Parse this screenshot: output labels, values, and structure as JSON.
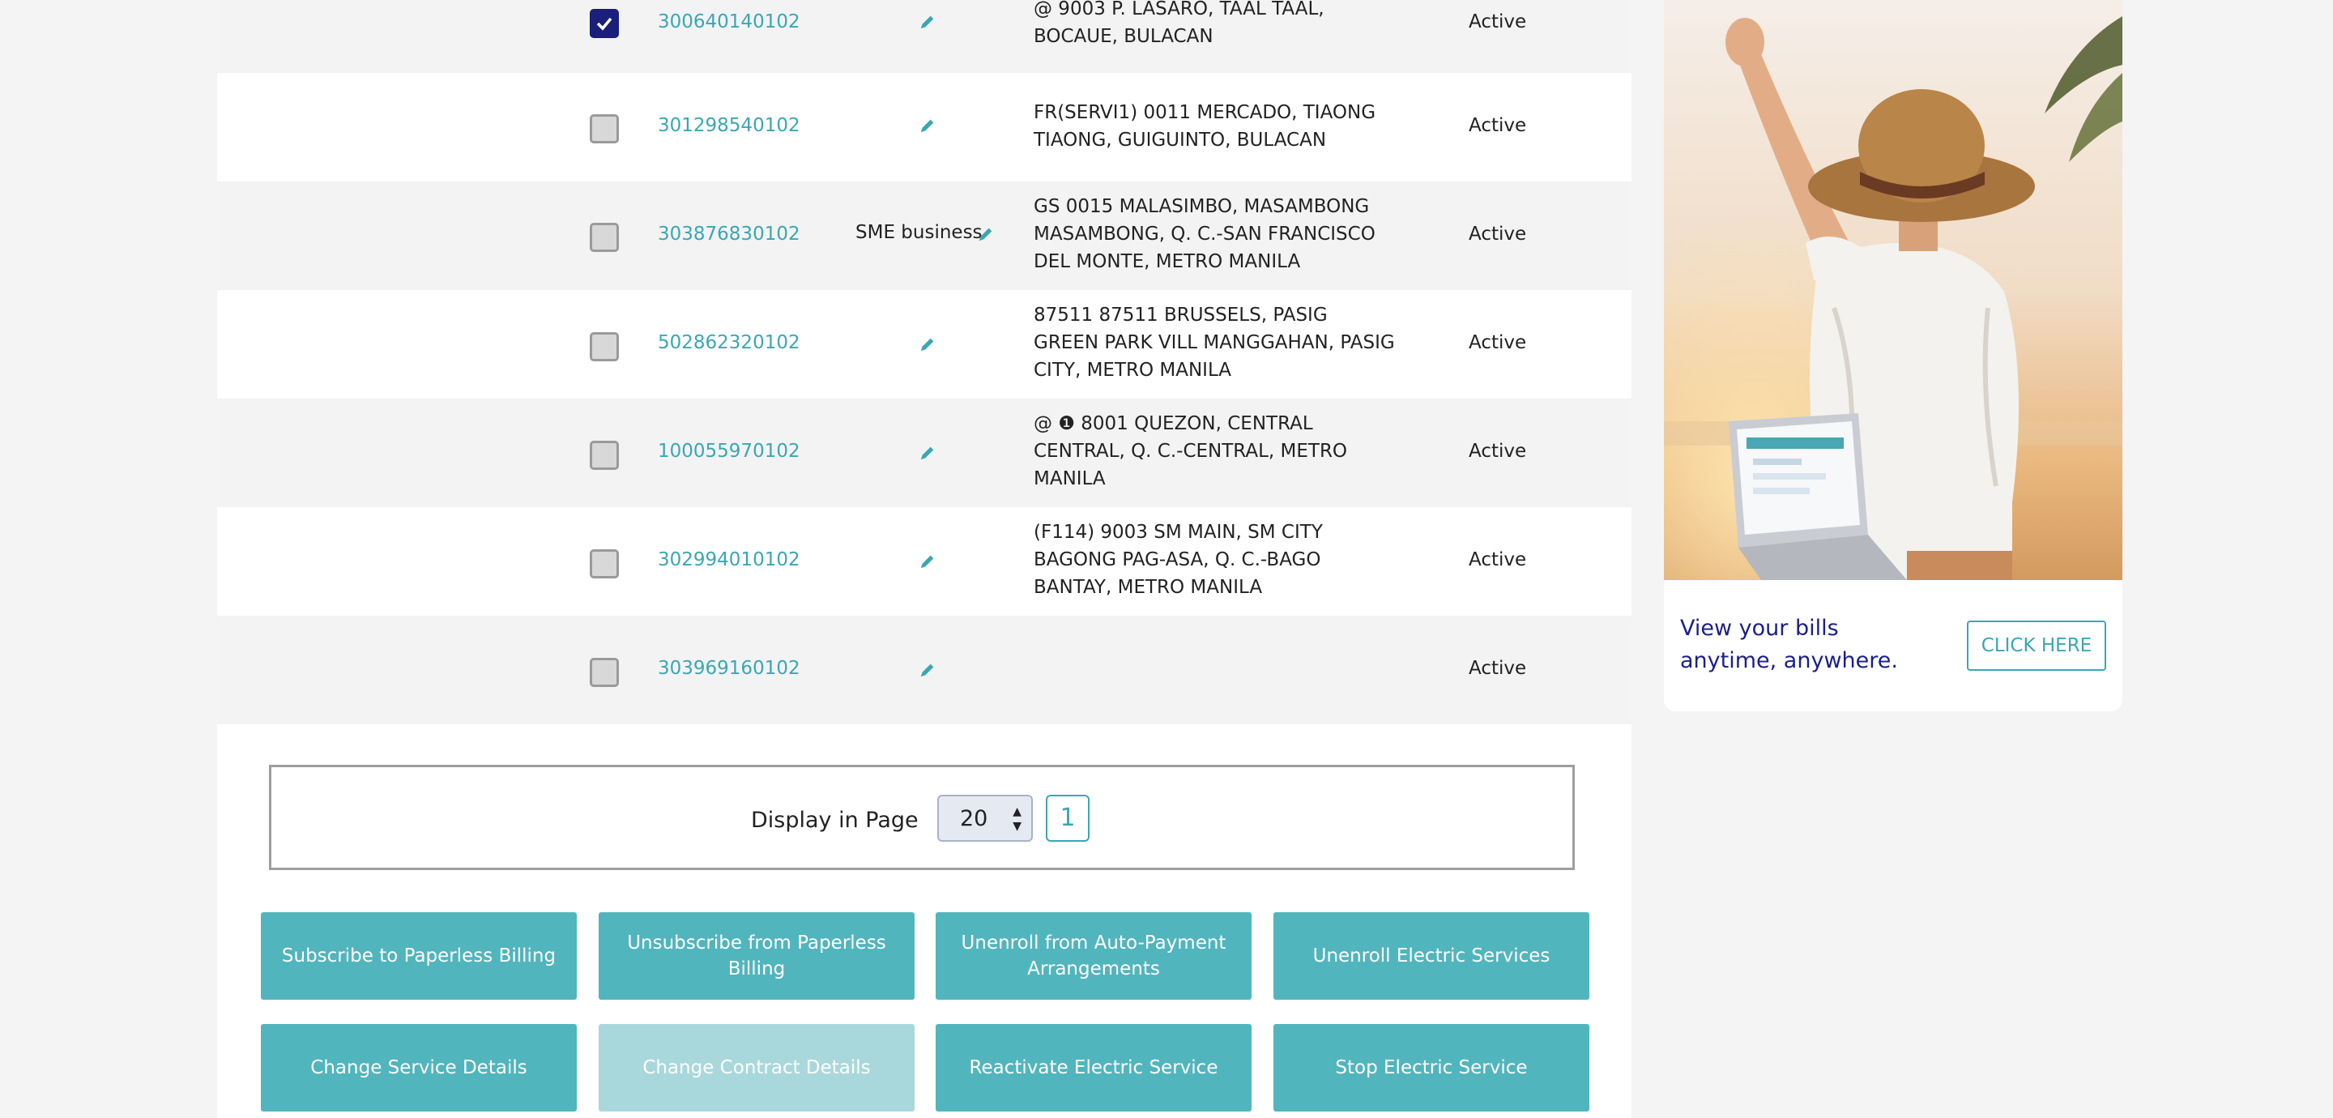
{
  "table": {
    "rows": [
      {
        "checked": true,
        "account": "300640140102",
        "service": "",
        "address": "@ 9003 P. LASARO, TAAL TAAL, BOCAUE, BULACAN",
        "status": "Active"
      },
      {
        "checked": false,
        "account": "301298540102",
        "service": "",
        "address": "FR(SERVI1) 0011 MERCADO, TIAONG TIAONG, GUIGUINTO, BULACAN",
        "status": "Active"
      },
      {
        "checked": false,
        "account": "303876830102",
        "service": "SME business",
        "address": "GS 0015 MALASIMBO, MASAMBONG MASAMBONG, Q. C.-SAN FRANCISCO DEL MONTE, METRO MANILA",
        "status": "Active"
      },
      {
        "checked": false,
        "account": "502862320102",
        "service": "",
        "address": "87511 87511 BRUSSELS, PASIG GREEN PARK VILL MANGGAHAN, PASIG CITY, METRO MANILA",
        "status": "Active"
      },
      {
        "checked": false,
        "account": "100055970102",
        "service": "",
        "address": "@ ❶ 8001 QUEZON, CENTRAL CENTRAL, Q. C.-CENTRAL, METRO MANILA",
        "status": "Active"
      },
      {
        "checked": false,
        "account": "302994010102",
        "service": "",
        "address": "(F114) 9003 SM MAIN, SM CITY BAGONG PAG-ASA, Q. C.-BAGO BANTAY, METRO MANILA",
        "status": "Active"
      },
      {
        "checked": false,
        "account": "303969160102",
        "service": "",
        "address": "",
        "status": "Active"
      }
    ]
  },
  "pagination": {
    "label": "Display in Page",
    "page_size": "20",
    "current_page": "1"
  },
  "actions": {
    "subscribe_paperless": "Subscribe to Paperless Billing",
    "unsubscribe_paperless": "Unsubscribe from Paperless Billing",
    "unenroll_autopay": "Unenroll from Auto-Payment Arrangements",
    "unenroll_electric": "Unenroll Electric Services",
    "change_service": "Change Service Details",
    "change_contract": "Change Contract Details",
    "reactivate_electric": "Reactivate Electric Service",
    "stop_electric": "Stop Electric Service"
  },
  "promo": {
    "text": "View your bills anytime, anywhere.",
    "button": "CLICK HERE"
  },
  "colors": {
    "accent": "#51b5bd",
    "link": "#3aa7b3",
    "navy": "#1b1f7a"
  },
  "icons": {
    "edit": "pencil-icon",
    "checkbox": "checkbox-icon"
  }
}
